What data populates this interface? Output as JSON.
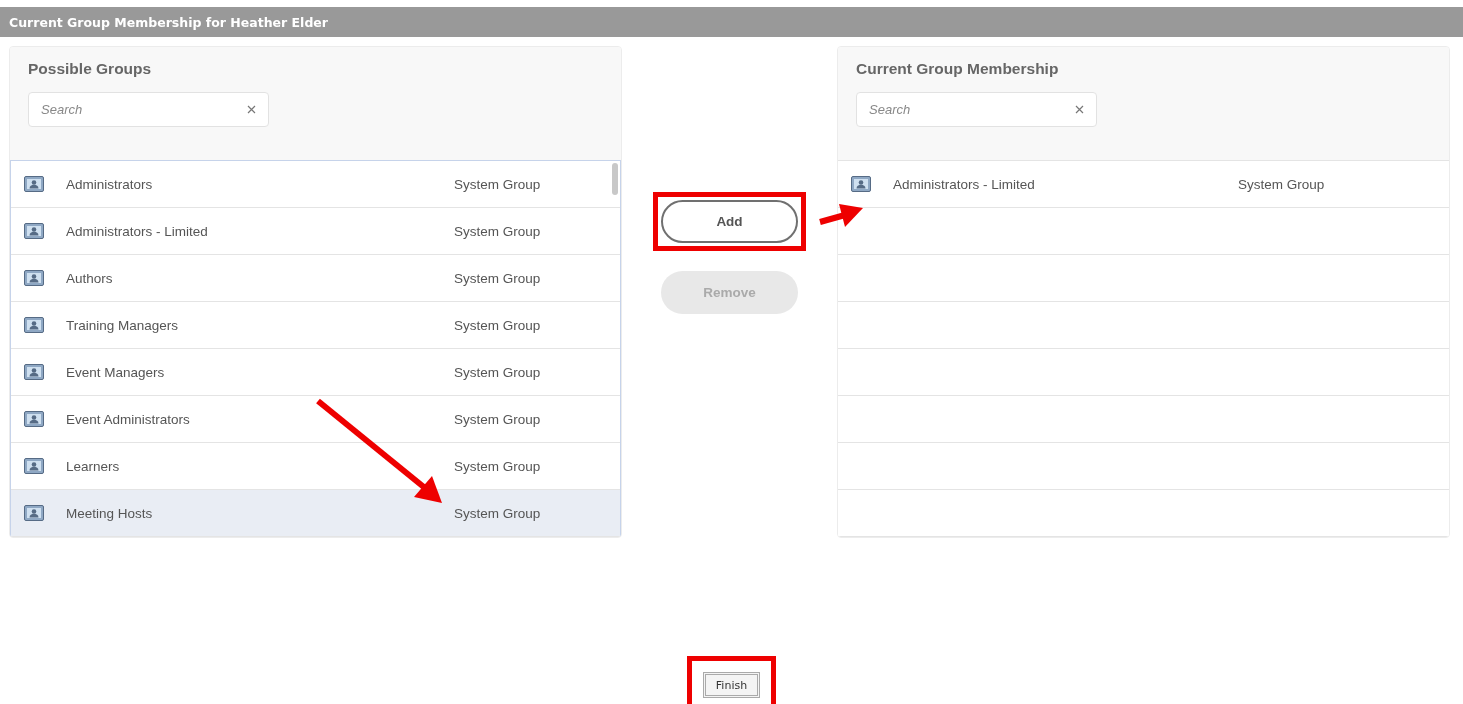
{
  "header": {
    "title": "Current Group Membership for Heather Elder"
  },
  "possible_groups": {
    "title": "Possible Groups",
    "search": {
      "placeholder": "Search"
    },
    "rows": [
      {
        "name": "Administrators",
        "type": "System Group",
        "selected": false
      },
      {
        "name": "Administrators - Limited",
        "type": "System Group",
        "selected": false
      },
      {
        "name": "Authors",
        "type": "System Group",
        "selected": false
      },
      {
        "name": "Training Managers",
        "type": "System Group",
        "selected": false
      },
      {
        "name": "Event Managers",
        "type": "System Group",
        "selected": false
      },
      {
        "name": "Event Administrators",
        "type": "System Group",
        "selected": false
      },
      {
        "name": "Learners",
        "type": "System Group",
        "selected": false
      },
      {
        "name": "Meeting Hosts",
        "type": "System Group",
        "selected": true
      }
    ]
  },
  "actions": [
    {
      "label": "Add",
      "disabled": false,
      "highlighted": true
    },
    {
      "label": "Remove",
      "disabled": true,
      "highlighted": false
    }
  ],
  "current_membership": {
    "title": "Current Group Membership",
    "search": {
      "placeholder": "Search"
    },
    "rows": [
      {
        "name": "Administrators - Limited",
        "type": "System Group",
        "selected": false
      }
    ]
  },
  "finish": {
    "label": "Finish",
    "highlighted": true
  },
  "annotations": {
    "arrow_to_selected_row": true,
    "arrow_to_current_list": true
  }
}
